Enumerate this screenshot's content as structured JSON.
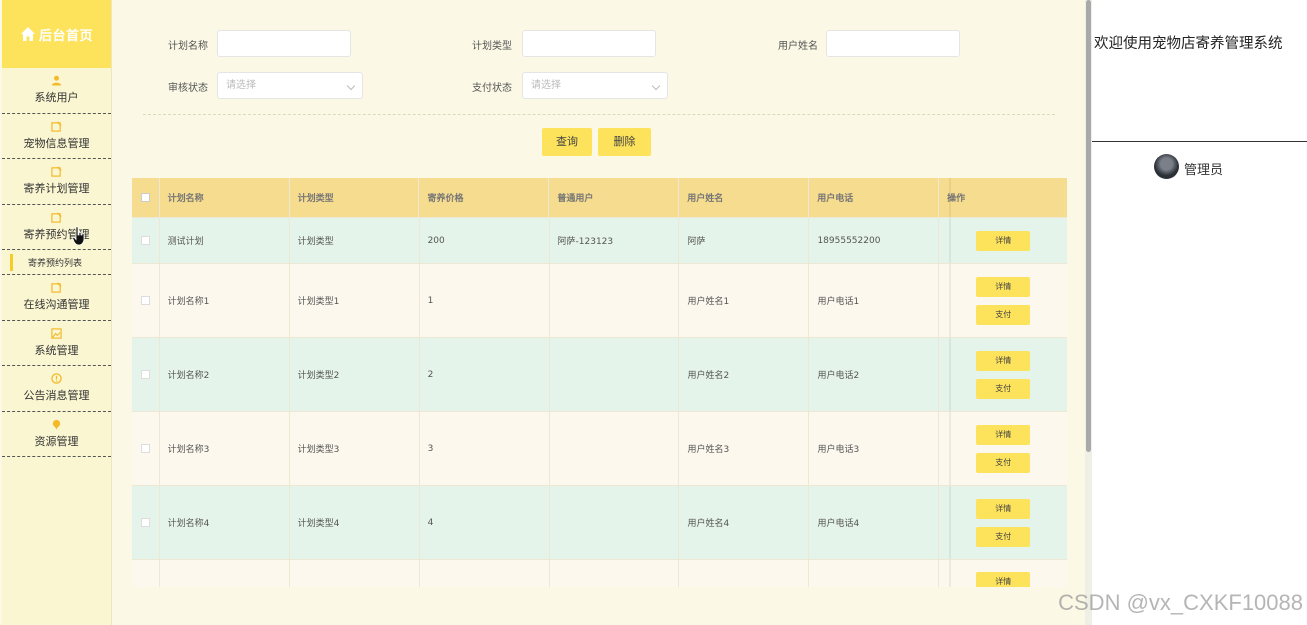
{
  "sidebar": {
    "home": "后台首页",
    "items": [
      {
        "label": "系统用户",
        "icon": "user-icon"
      },
      {
        "label": "宠物信息管理",
        "icon": "edit-icon"
      },
      {
        "label": "寄养计划管理",
        "icon": "edit-icon"
      },
      {
        "label": "寄养预约管理",
        "icon": "edit-icon"
      },
      {
        "label": "在线沟通管理",
        "icon": "edit-icon"
      },
      {
        "label": "系统管理",
        "icon": "image-icon"
      },
      {
        "label": "公告消息管理",
        "icon": "info-icon"
      },
      {
        "label": "资源管理",
        "icon": "pin-icon"
      }
    ],
    "sub_item": "寄养预约列表"
  },
  "filters": {
    "plan_name_label": "计划名称",
    "plan_name_value": "",
    "plan_type_label": "计划类型",
    "plan_type_value": "",
    "user_name_label": "用户姓名",
    "user_name_value": "",
    "audit_label": "审核状态",
    "audit_placeholder": "请选择",
    "pay_label": "支付状态",
    "pay_placeholder": "请选择"
  },
  "actions": {
    "query": "查询",
    "delete": "删除"
  },
  "table": {
    "headers": [
      "计划名称",
      "计划类型",
      "寄养价格",
      "普通用户",
      "用户姓名",
      "用户电话",
      "操作"
    ],
    "rows": [
      {
        "name": "测试计划",
        "type": "计划类型",
        "price": "200",
        "user": "阿萨-123123",
        "uname": "阿萨",
        "phone": "18955552200",
        "buttons": [
          "详情"
        ]
      },
      {
        "name": "计划名称1",
        "type": "计划类型1",
        "price": "1",
        "user": "",
        "uname": "用户姓名1",
        "phone": "用户电话1",
        "buttons": [
          "详情",
          "支付"
        ]
      },
      {
        "name": "计划名称2",
        "type": "计划类型2",
        "price": "2",
        "user": "",
        "uname": "用户姓名2",
        "phone": "用户电话2",
        "buttons": [
          "详情",
          "支付"
        ]
      },
      {
        "name": "计划名称3",
        "type": "计划类型3",
        "price": "3",
        "user": "",
        "uname": "用户姓名3",
        "phone": "用户电话3",
        "buttons": [
          "详情",
          "支付"
        ]
      },
      {
        "name": "计划名称4",
        "type": "计划类型4",
        "price": "4",
        "user": "",
        "uname": "用户姓名4",
        "phone": "用户电话4",
        "buttons": [
          "详情",
          "支付"
        ]
      },
      {
        "name": "",
        "type": "",
        "price": "",
        "user": "",
        "uname": "",
        "phone": "",
        "buttons": [
          "详情"
        ]
      }
    ]
  },
  "right_panel": {
    "welcome": "欢迎使用宠物店寄养管理系统",
    "username": "管理员"
  },
  "watermark": "CSDN @vx_CXKF10088",
  "colors": {
    "accent": "#fde25b",
    "sidebar_bg": "#faf6d2",
    "table_header": "#f6dc8e",
    "row_green": "#e5f4ea",
    "row_cream": "#fcf8ee"
  }
}
